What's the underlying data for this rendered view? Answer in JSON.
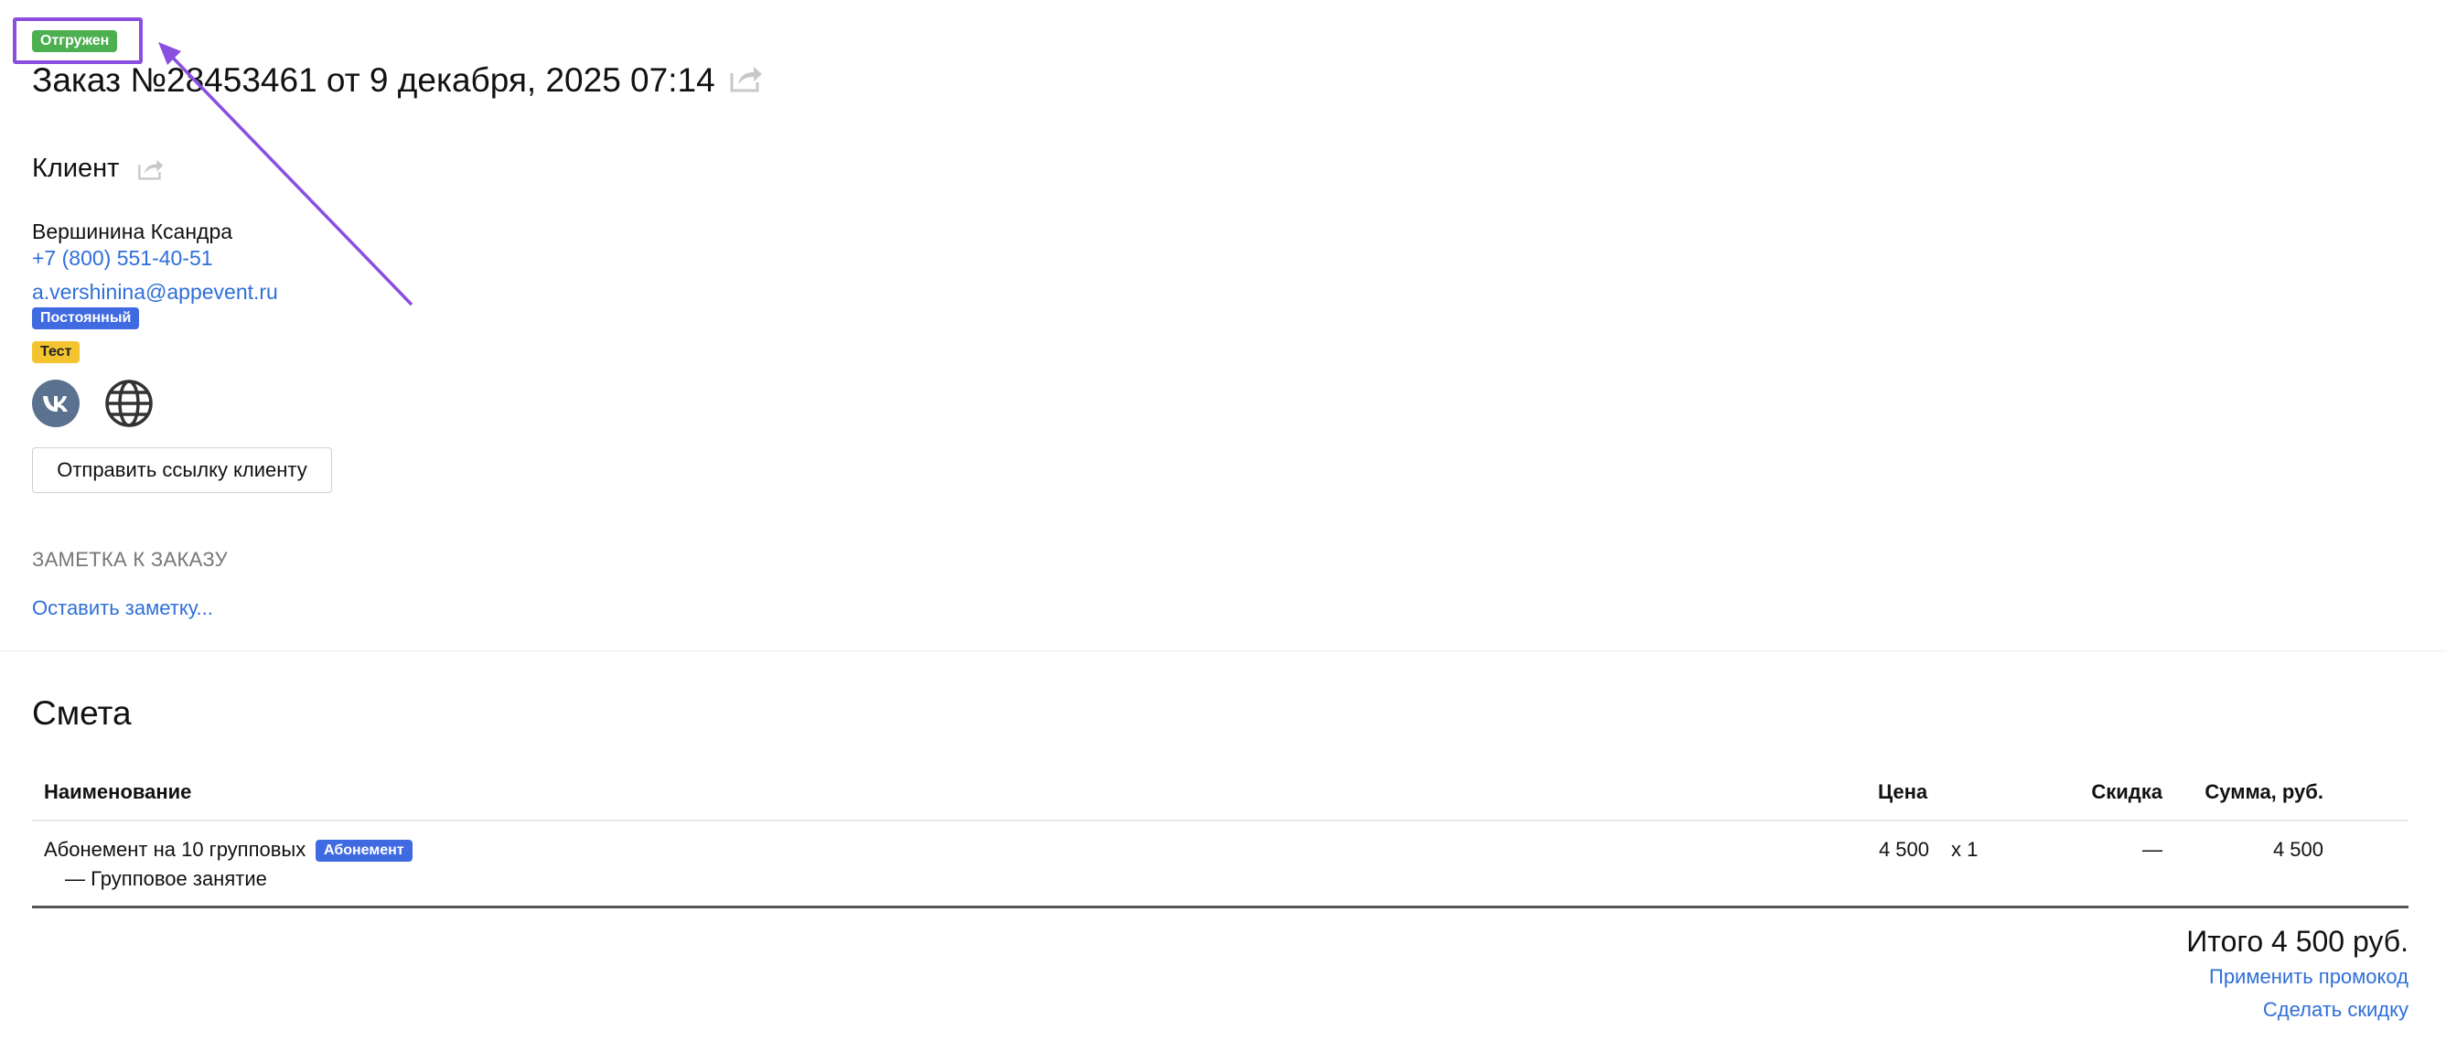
{
  "order": {
    "status_badge": "Отгружен",
    "title": "Заказ №28453461 от 9 декабря, 2025 07:14",
    "share_icon": "share-icon"
  },
  "client": {
    "heading": "Клиент",
    "share_icon": "share-icon",
    "name": "Вершинина Ксандра",
    "phone": "+7 (800) 551-40-51",
    "email": "a.vershinina@appevent.ru",
    "tags": [
      {
        "label": "Постоянный",
        "color": "#3f6ae2"
      },
      {
        "label": "Тест",
        "color": "#f4c430"
      }
    ],
    "social_icons": [
      "vk-icon",
      "globe-icon"
    ],
    "send_link_button": "Отправить ссылку клиенту"
  },
  "note": {
    "heading": "ЗАМЕТКА К ЗАКАЗУ",
    "leave_note_link": "Оставить заметку..."
  },
  "estimate": {
    "heading": "Смета",
    "columns": {
      "name": "Наименование",
      "price": "Цена",
      "discount": "Скидка",
      "sum": "Сумма, руб."
    },
    "rows": [
      {
        "name": "Абонемент на 10 групповых",
        "badge": "Абонемент",
        "sub": "— Групповое занятие",
        "price": "4 500",
        "qty": "x 1",
        "discount": "—",
        "sum": "4 500"
      }
    ],
    "total": "Итого 4 500 руб.",
    "apply_promo_link": "Применить промокод",
    "discount_link": "Сделать скидку"
  },
  "colors": {
    "accent_link": "#2f6fd8",
    "status_green": "#4caf50",
    "annotation_purple": "#8a4fe0"
  }
}
